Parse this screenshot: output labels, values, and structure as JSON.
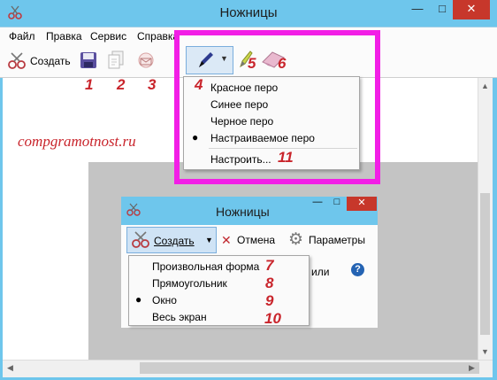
{
  "window": {
    "title": "Ножницы",
    "minimize_glyph": "—",
    "maximize_glyph": "□",
    "close_glyph": "✕"
  },
  "menu": [
    "Файл",
    "Правка",
    "Сервис",
    "Справка"
  ],
  "toolbar": {
    "new_label": "Создать",
    "icons": [
      "scissors-icon",
      "save-icon",
      "copy-icon",
      "send-email-icon",
      "pen-icon",
      "highlighter-icon",
      "eraser-icon"
    ]
  },
  "annotations": [
    "1",
    "2",
    "3",
    "4",
    "5",
    "6",
    "7",
    "8",
    "9",
    "10",
    "11"
  ],
  "watermark": "compgramotnost.ru",
  "pen_menu": {
    "items": [
      "Красное перо",
      "Синее перо",
      "Черное перо",
      "Настраиваемое перо"
    ],
    "selected_index": 3,
    "settings": "Настроить..."
  },
  "inner_window": {
    "title": "Ножницы",
    "new_label": "Создать",
    "cancel_label": "Отмена",
    "options_label": "Параметры",
    "partial_text": "или",
    "help_glyph": "?"
  },
  "mode_menu": {
    "items": [
      "Произвольная форма",
      "Прямоугольник",
      "Окно",
      "Весь экран"
    ],
    "selected_index": 2
  },
  "colors": {
    "accent": "#6ec6ec",
    "highlight": "#f21ee6",
    "annotation": "#c9252c",
    "close": "#c7372b"
  }
}
